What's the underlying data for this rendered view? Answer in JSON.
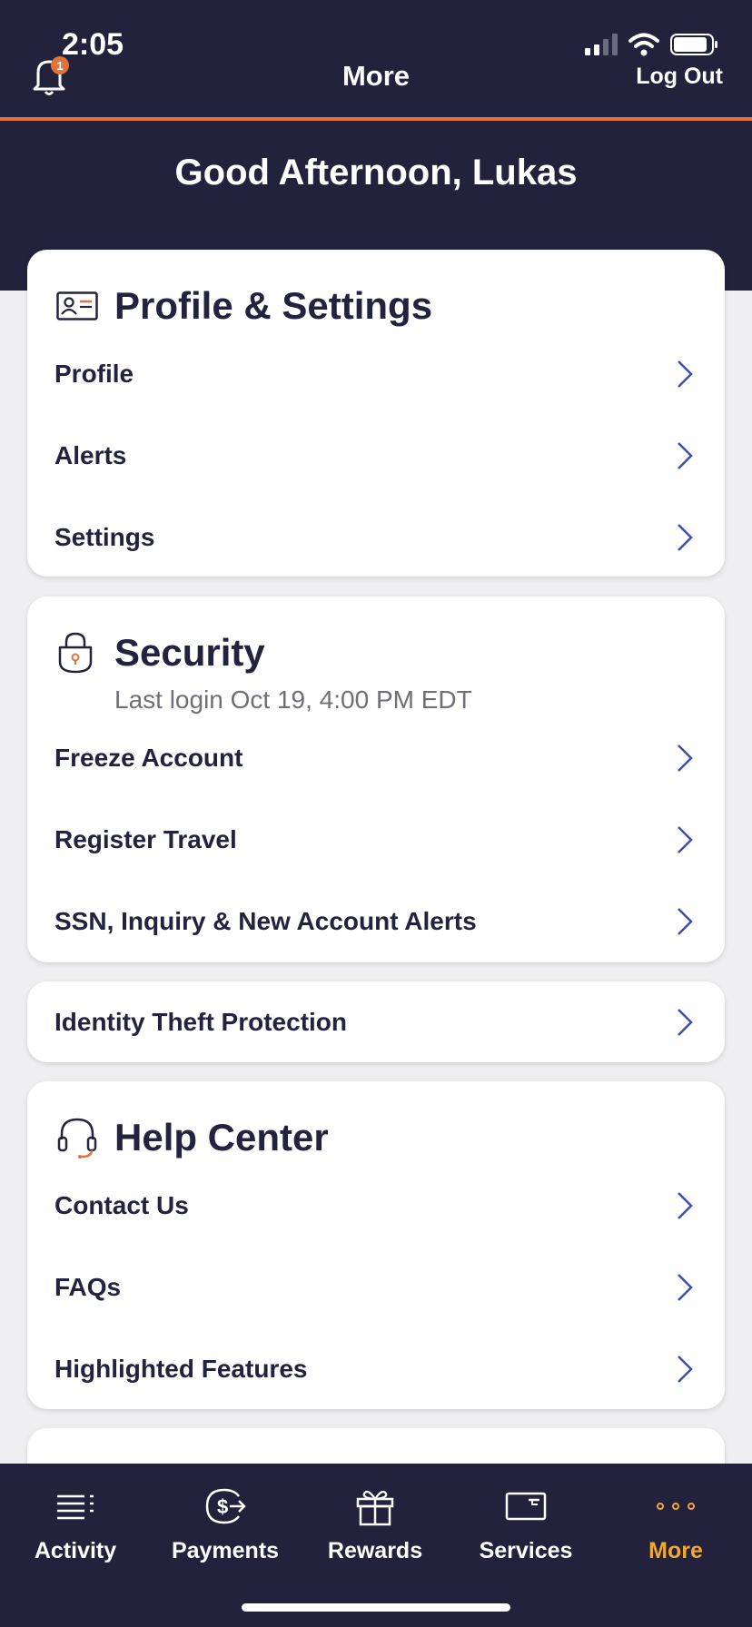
{
  "status_bar": {
    "time": "2:05"
  },
  "nav": {
    "title": "More",
    "logout_label": "Log Out",
    "notification_count": "1"
  },
  "greeting": "Good Afternoon, Lukas",
  "profile_section": {
    "title": "Profile & Settings",
    "items": [
      {
        "label": "Profile"
      },
      {
        "label": "Alerts"
      },
      {
        "label": "Settings"
      }
    ]
  },
  "security_section": {
    "title": "Security",
    "subtitle": "Last login Oct 19, 4:00 PM EDT",
    "items": [
      {
        "label": "Freeze Account"
      },
      {
        "label": "Register Travel"
      },
      {
        "label": "SSN, Inquiry & New Account Alerts"
      }
    ]
  },
  "identity_section": {
    "label": "Identity Theft Protection"
  },
  "help_section": {
    "title": "Help Center",
    "items": [
      {
        "label": "Contact Us"
      },
      {
        "label": "FAQs"
      },
      {
        "label": "Highlighted Features"
      }
    ]
  },
  "tabbar": {
    "tabs": [
      {
        "label": "Activity",
        "icon": "activity-icon"
      },
      {
        "label": "Payments",
        "icon": "payments-icon"
      },
      {
        "label": "Rewards",
        "icon": "gift-icon"
      },
      {
        "label": "Services",
        "icon": "card-icon"
      },
      {
        "label": "More",
        "icon": "more-dots-icon"
      }
    ],
    "active_tab": "More"
  },
  "colors": {
    "navy": "#22223d",
    "accent_orange": "#e0733a",
    "active_tab": "#f0a830",
    "chevron": "#3b4ea8"
  }
}
